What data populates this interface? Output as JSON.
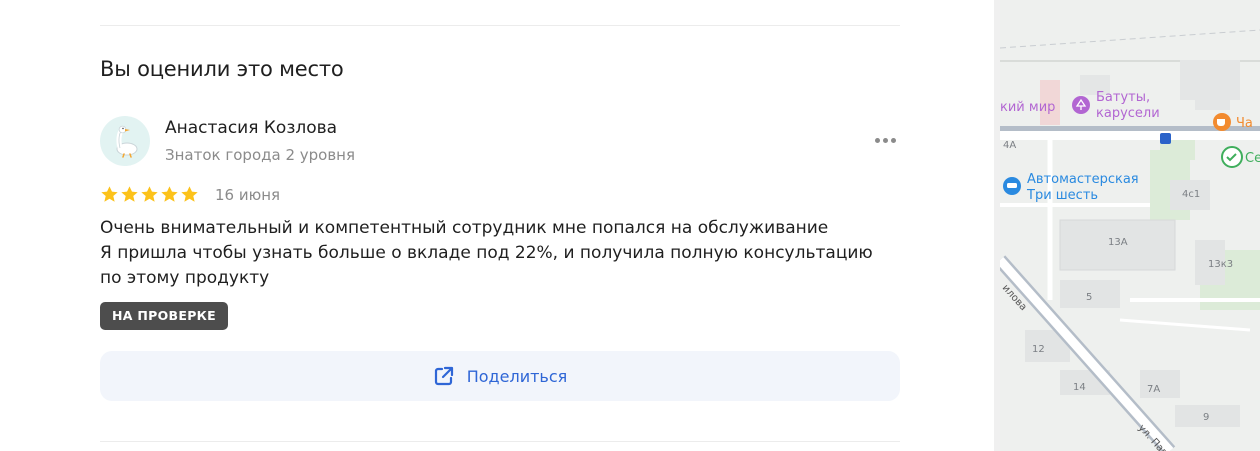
{
  "review_section": {
    "title": "Вы оценили это место",
    "author": {
      "name": "Анастасия Козлова",
      "level": "Знаток города 2 уровня",
      "avatar_icon": "goose-icon"
    },
    "more_icon": "more-dots-icon",
    "rating": 5,
    "date": "16 июня",
    "text_lines": [
      "Очень внимательный и компетентный сотрудник мне попался на обслуживание",
      "Я пришла чтобы узнать больше о вкладе под 22%, и получила полную консультацию",
      "по этому продукту"
    ],
    "status_badge": "НА ПРОВЕРКЕ",
    "share": {
      "label": "Поделиться",
      "icon": "share-external-icon"
    }
  },
  "map": {
    "pois": [
      {
        "name": "кий мир",
        "icon": "none"
      },
      {
        "name": "Батуты,",
        "name_line2": "карусели",
        "icon": "carousel-icon"
      },
      {
        "name": "Ча",
        "icon": "cafe-icon"
      },
      {
        "name": "Автомастерская",
        "name_line2": "Три шесть",
        "icon": "car-service-icon"
      },
      {
        "name": "Се",
        "icon": "bank-icon"
      }
    ],
    "labels": [
      "4А",
      "4с1",
      "13А",
      "13к3",
      "5",
      "12",
      "14",
      "7А",
      "9",
      "илова",
      "ул. Пав"
    ],
    "colors": {
      "accent": "#2f66d6",
      "star": "#fcc21b",
      "poi_purple": "#b266d2",
      "poi_blue": "#2a8ae0",
      "poi_orange": "#f28b2f",
      "poi_green": "#3fae5c"
    }
  }
}
